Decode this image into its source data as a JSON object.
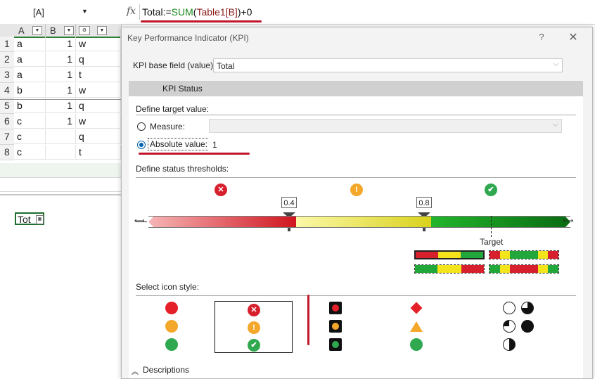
{
  "formula_bar": {
    "name_box": "[A]",
    "fx": "fx",
    "formula_prefix": "Total:=",
    "formula_fn": "SUM",
    "formula_open": "(",
    "formula_table": "Table1[B]",
    "formula_suffix": ")+0"
  },
  "sheet": {
    "columns": [
      "A",
      "B",
      ""
    ],
    "rows": [
      {
        "n": "1",
        "a": "a",
        "b": "1",
        "c": "w"
      },
      {
        "n": "2",
        "a": "a",
        "b": "1",
        "c": "q"
      },
      {
        "n": "3",
        "a": "a",
        "b": "1",
        "c": "t"
      },
      {
        "n": "4",
        "a": "b",
        "b": "1",
        "c": "w"
      },
      {
        "n": "5",
        "a": "b",
        "b": "1",
        "c": "q"
      },
      {
        "n": "6",
        "a": "c",
        "b": "1",
        "c": "w"
      },
      {
        "n": "7",
        "a": "c",
        "b": "",
        "c": "q"
      },
      {
        "n": "8",
        "a": "c",
        "b": "",
        "c": "t"
      }
    ],
    "total_cell": "Tot"
  },
  "dialog": {
    "title": "Key Performance Indicator (KPI)",
    "help": "?",
    "close": "✕",
    "base_field_label": "KPI base field (value):",
    "base_field_value": "Total",
    "tab_label": "KPI Status",
    "define_target_label": "Define target value:",
    "measure_label": "Measure:",
    "absolute_label": "Absolute value:",
    "absolute_value": "1",
    "thresholds_label": "Define status thresholds:",
    "threshold_low": "0.4",
    "threshold_high": "0.8",
    "target_label": "Target",
    "icon_style_label": "Select icon style:",
    "descriptions_label": "Descriptions",
    "selected_option": "absolute-value"
  },
  "colors": {
    "bad": "#d7202e",
    "warn": "#f4a82b",
    "good": "#2fa84f",
    "accent": "#0063b1",
    "annotation": "#c0152a"
  }
}
